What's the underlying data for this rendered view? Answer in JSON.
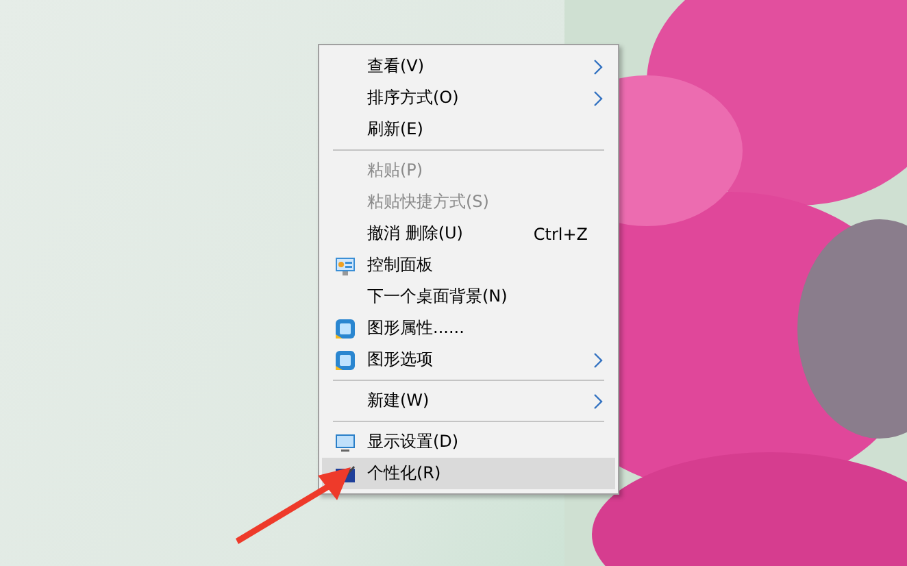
{
  "context_menu": {
    "items": [
      {
        "kind": "item",
        "label": "查看(V)",
        "submenu": true,
        "disabled": false,
        "selected": false
      },
      {
        "kind": "item",
        "label": "排序方式(O)",
        "submenu": true,
        "disabled": false,
        "selected": false
      },
      {
        "kind": "item",
        "label": "刷新(E)",
        "submenu": false,
        "disabled": false,
        "selected": false
      },
      {
        "kind": "separator"
      },
      {
        "kind": "item",
        "label": "粘贴(P)",
        "submenu": false,
        "disabled": true,
        "selected": false
      },
      {
        "kind": "item",
        "label": "粘贴快捷方式(S)",
        "submenu": false,
        "disabled": true,
        "selected": false
      },
      {
        "kind": "item",
        "label": "撤消 删除(U)",
        "shortcut": "Ctrl+Z",
        "submenu": false,
        "disabled": false,
        "selected": false
      },
      {
        "kind": "panel",
        "label": "控制面板",
        "submenu": false,
        "disabled": false,
        "selected": false
      },
      {
        "kind": "item",
        "label": "下一个桌面背景(N)",
        "submenu": false,
        "disabled": false,
        "selected": false
      },
      {
        "kind": "graphics",
        "label": "图形属性......",
        "submenu": false,
        "disabled": false,
        "selected": false
      },
      {
        "kind": "graphics",
        "label": "图形选项",
        "submenu": true,
        "disabled": false,
        "selected": false
      },
      {
        "kind": "separator"
      },
      {
        "kind": "item",
        "label": "新建(W)",
        "submenu": true,
        "disabled": false,
        "selected": false
      },
      {
        "kind": "separator"
      },
      {
        "kind": "display",
        "label": "显示设置(D)",
        "submenu": false,
        "disabled": false,
        "selected": false
      },
      {
        "kind": "brush",
        "label": "个性化(R)",
        "submenu": false,
        "disabled": false,
        "selected": true
      }
    ]
  }
}
